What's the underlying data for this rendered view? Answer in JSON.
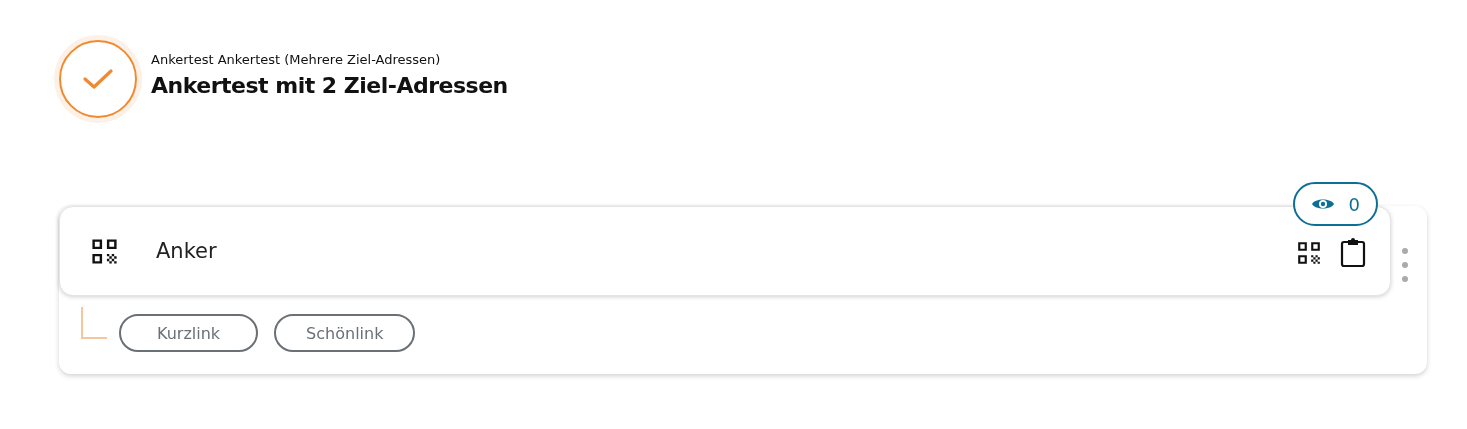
{
  "header": {
    "done": true,
    "subtitle": "Ankertest Ankertest (Mehrere Ziel-Adressen)",
    "title": "Ankertest mit 2 Ziel-Adressen"
  },
  "entry": {
    "name": "Anker",
    "views": "0",
    "links": [
      {
        "label": "Kurzlink"
      },
      {
        "label": "Schönlink"
      }
    ]
  }
}
